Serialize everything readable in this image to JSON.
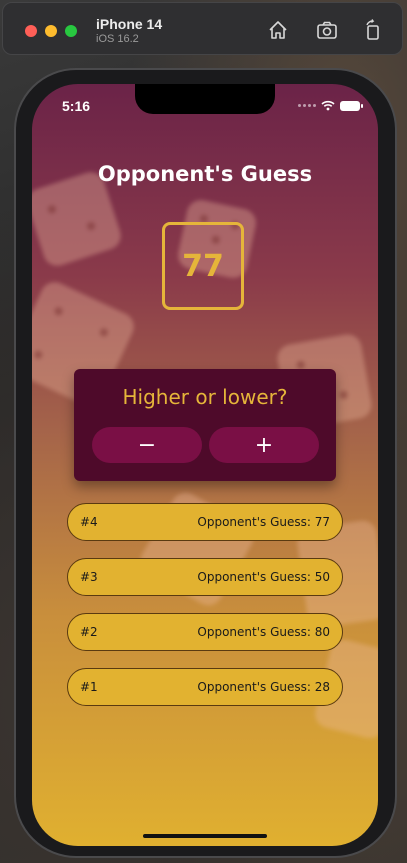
{
  "simulator": {
    "device_name": "iPhone 14",
    "os_version": "iOS 16.2",
    "icons": [
      "home-icon",
      "screenshot-icon",
      "rotate-icon"
    ]
  },
  "status_bar": {
    "time": "5:16",
    "icons": [
      "wifi-icon",
      "battery-icon"
    ]
  },
  "screen": {
    "title": "Opponent's Guess",
    "guess_value": "77",
    "prompt": "Higher or lower?",
    "minus_label": "−",
    "plus_label": "+"
  },
  "guess_log": [
    {
      "round": "#4",
      "text": "Opponent's Guess: 77"
    },
    {
      "round": "#3",
      "text": "Opponent's Guess: 50"
    },
    {
      "round": "#2",
      "text": "Opponent's Guess: 80"
    },
    {
      "round": "#1",
      "text": "Opponent's Guess: 28"
    }
  ],
  "colors": {
    "accent": "#e5b53a",
    "card_bg": "#4e0a2a",
    "button_bg": "#7a0f45"
  }
}
